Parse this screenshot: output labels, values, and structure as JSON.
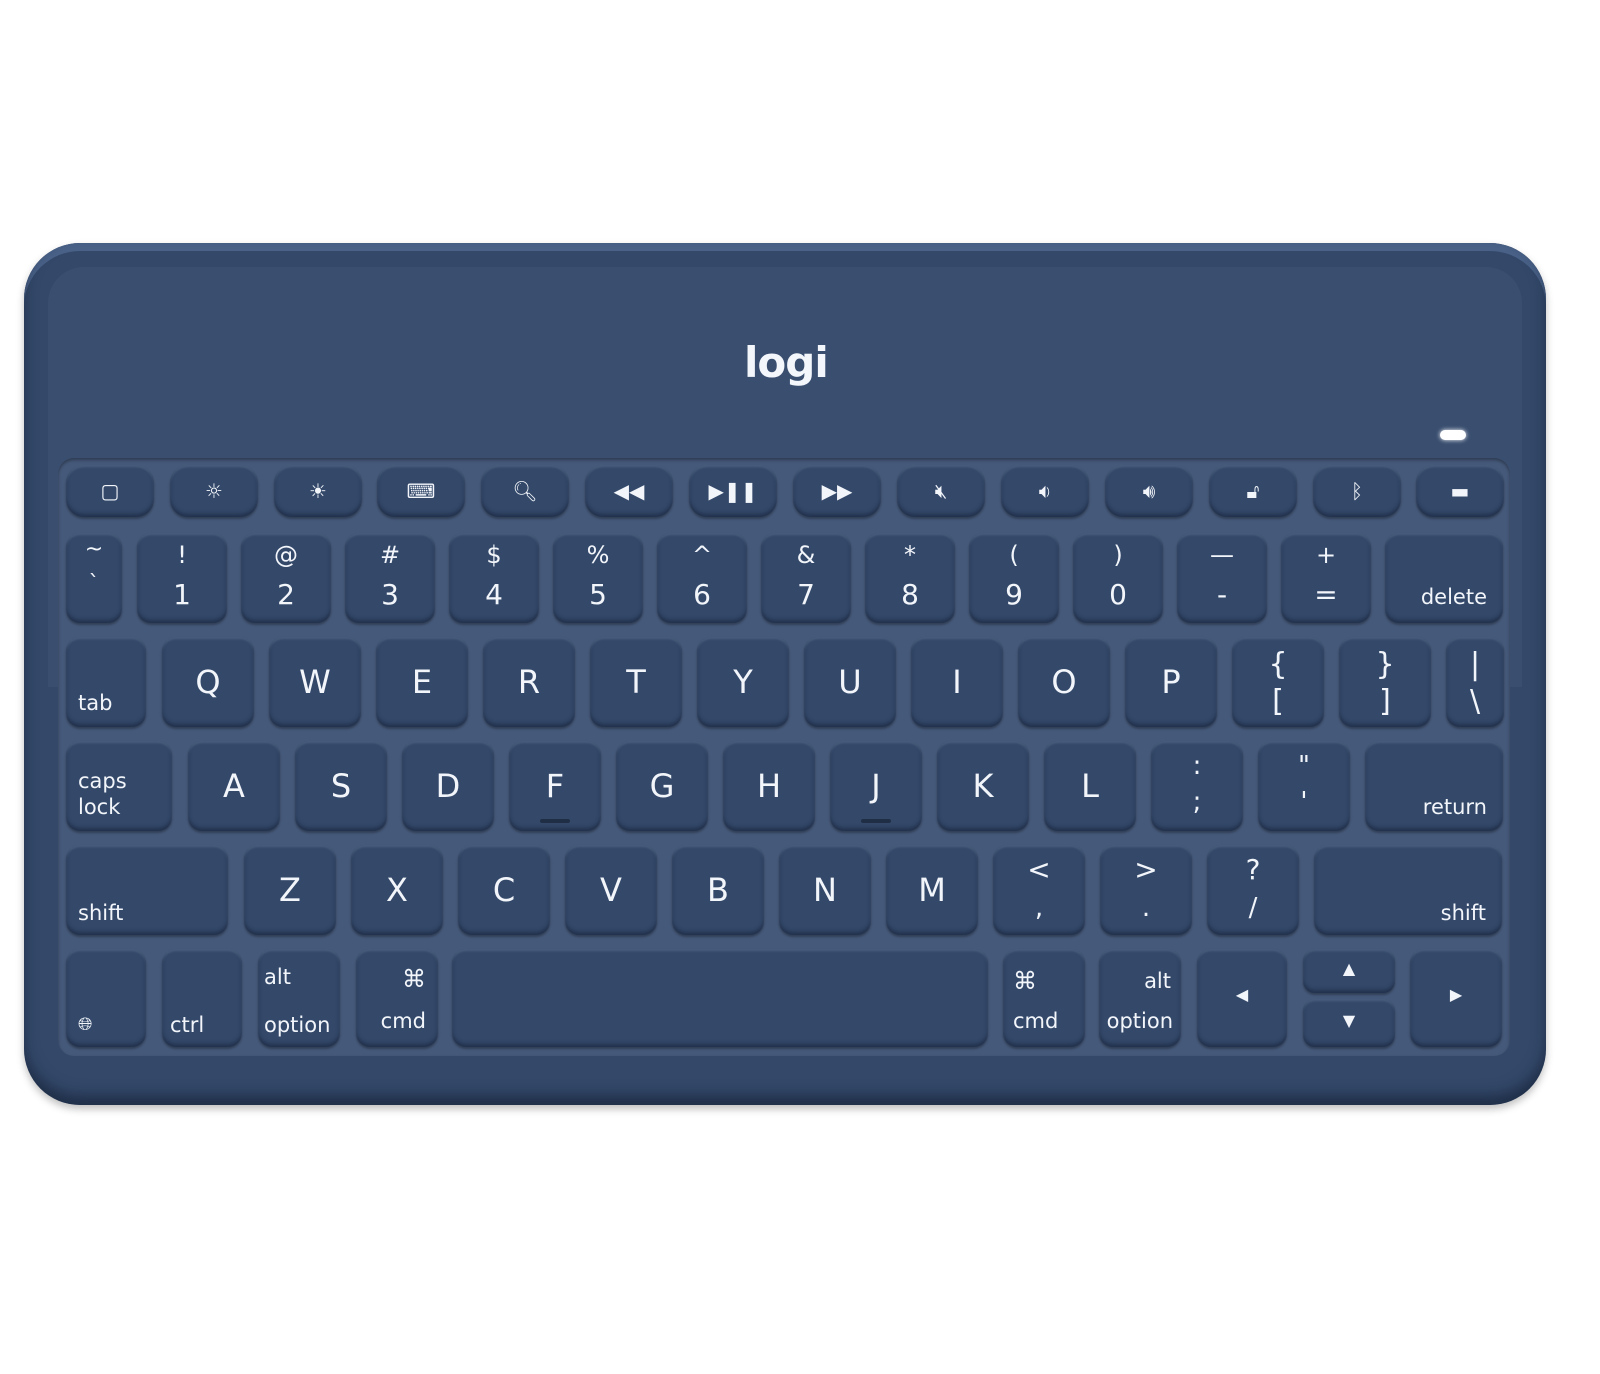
{
  "product": {
    "brand_logo": "logi",
    "color": "#34496a",
    "accent_text_color": "#f2f5fa",
    "status_led": "on"
  },
  "function_row": [
    {
      "icon": "home-icon",
      "glyph": "▢"
    },
    {
      "icon": "brightness-down-icon",
      "glyph": "☼"
    },
    {
      "icon": "brightness-up-icon",
      "glyph": "☀"
    },
    {
      "icon": "keyboard-icon",
      "glyph": "⌨"
    },
    {
      "icon": "search-icon",
      "glyph": "🔍︎"
    },
    {
      "icon": "rewind-icon",
      "glyph": "◀◀"
    },
    {
      "icon": "play-pause-icon",
      "glyph": "▶❚❚"
    },
    {
      "icon": "fast-forward-icon",
      "glyph": "▶▶"
    },
    {
      "icon": "mute-icon",
      "glyph": "🔇︎"
    },
    {
      "icon": "volume-down-icon",
      "glyph": "🔉︎"
    },
    {
      "icon": "volume-up-icon",
      "glyph": "🔊︎"
    },
    {
      "icon": "lock-icon",
      "glyph": "🔓︎"
    },
    {
      "icon": "bluetooth-icon",
      "glyph": "ᛒ"
    },
    {
      "icon": "battery-icon",
      "glyph": "▬"
    }
  ],
  "number_row": [
    {
      "top": "~",
      "bottom": "`"
    },
    {
      "top": "!",
      "bottom": "1"
    },
    {
      "top": "@",
      "bottom": "2"
    },
    {
      "top": "#",
      "bottom": "3"
    },
    {
      "top": "$",
      "bottom": "4"
    },
    {
      "top": "%",
      "bottom": "5"
    },
    {
      "top": "^",
      "bottom": "6"
    },
    {
      "top": "&",
      "bottom": "7"
    },
    {
      "top": "*",
      "bottom": "8"
    },
    {
      "top": "(",
      "bottom": "9"
    },
    {
      "top": ")",
      "bottom": "0"
    },
    {
      "top": "—",
      "bottom": "-"
    },
    {
      "top": "+",
      "bottom": "="
    },
    {
      "label": "delete"
    }
  ],
  "qwerty_row": [
    {
      "label": "tab"
    },
    {
      "main": "Q"
    },
    {
      "main": "W"
    },
    {
      "main": "E"
    },
    {
      "main": "R"
    },
    {
      "main": "T"
    },
    {
      "main": "Y"
    },
    {
      "main": "U"
    },
    {
      "main": "I"
    },
    {
      "main": "O"
    },
    {
      "main": "P"
    },
    {
      "top": "{",
      "bottom": "["
    },
    {
      "top": "}",
      "bottom": "]"
    },
    {
      "top": "|",
      "bottom": "\\"
    }
  ],
  "home_row": [
    {
      "label_line1": "caps",
      "label_line2": "lock"
    },
    {
      "main": "A"
    },
    {
      "main": "S"
    },
    {
      "main": "D"
    },
    {
      "main": "F"
    },
    {
      "main": "G"
    },
    {
      "main": "H"
    },
    {
      "main": "J"
    },
    {
      "main": "K"
    },
    {
      "main": "L"
    },
    {
      "top": ":",
      "bottom": ";"
    },
    {
      "top": "\"",
      "bottom": "'"
    },
    {
      "label": "return"
    }
  ],
  "shift_row": [
    {
      "label": "shift"
    },
    {
      "main": "Z"
    },
    {
      "main": "X"
    },
    {
      "main": "C"
    },
    {
      "main": "V"
    },
    {
      "main": "B"
    },
    {
      "main": "N"
    },
    {
      "main": "M"
    },
    {
      "top": "<",
      "bottom": ","
    },
    {
      "top": ">",
      "bottom": "."
    },
    {
      "top": "?",
      "bottom": "/"
    },
    {
      "label": "shift"
    }
  ],
  "bottom_row": {
    "globe": "🌐︎",
    "ctrl": "ctrl",
    "alt_left_top": "alt",
    "alt_left_bottom": "option",
    "cmd_left_symbol": "⌘",
    "cmd_left_label": "cmd",
    "cmd_right_symbol": "⌘",
    "cmd_right_label": "cmd",
    "alt_right_top": "alt",
    "alt_right_bottom": "option",
    "arrow_left": "◀",
    "arrow_up": "▲",
    "arrow_down": "▼",
    "arrow_right": "▶"
  }
}
